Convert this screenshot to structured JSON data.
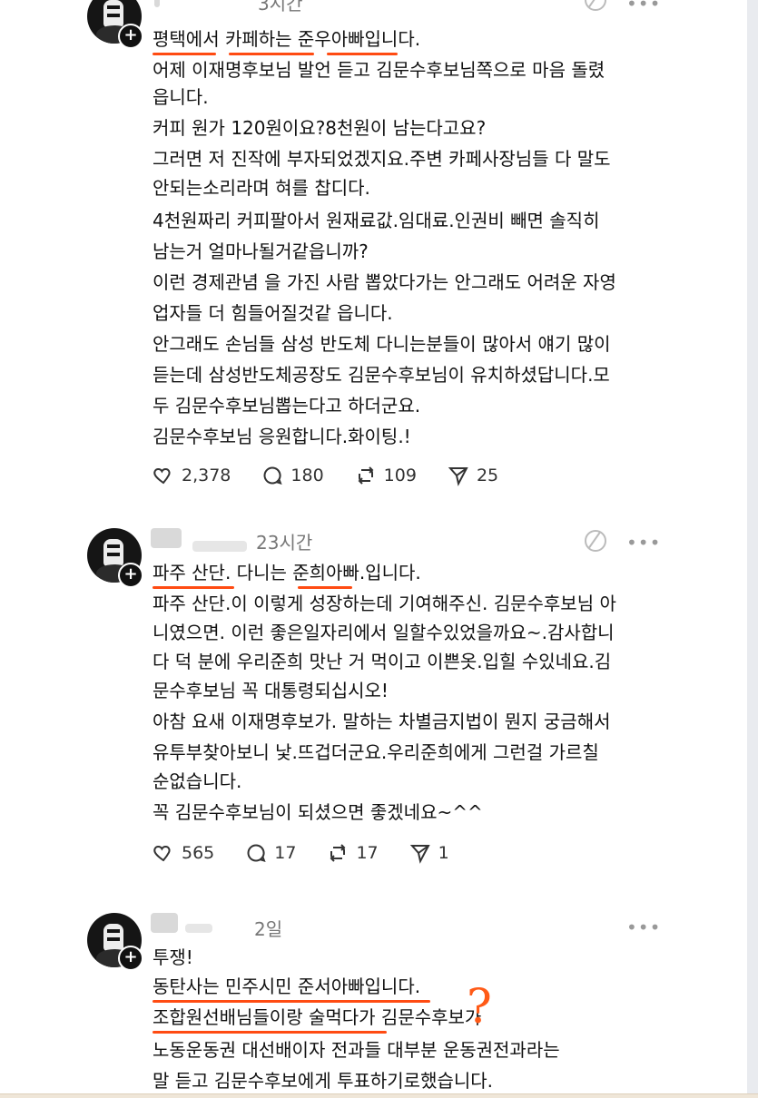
{
  "posts": [
    {
      "time": "3시간",
      "lines": [
        "평택에서 카페하는 준우아빠입니다.",
        "어제 이재명후보님 발언 듣고 김문수후보님쪽으로 마음 돌렸",
        "읍니다.",
        "커피 원가 120원이요?8천원이 남는다고요?",
        "그러면 저 진작에 부자되었겠지요.주변 카페사장님들 다 말도",
        "안되는소리라며 혀를 찹디다.",
        "4천원짜리 커피팔아서 원재료값.임대료.인권비 빼면 솔직히",
        "남는거 얼마나될거같읍니까?",
        "이런 경제관념 을 가진 사람 뽑았다가는 안그래도 어려운 자영",
        "업자들 더 힘들어질것같 읍니다.",
        "안그래도 손님들 삼성 반도체 다니는분들이 많아서 얘기 많이",
        "듣는데 삼성반도체공장도 김문수후보님이 유치하셨답니다.모",
        "두 김문수후보님뽑는다고 하더군요.",
        "김문수후보님 응원합니다.화이팅.!"
      ],
      "likes": "2,378",
      "replies": "180",
      "reposts": "109",
      "shares": "25"
    },
    {
      "time": "23시간",
      "lines": [
        "파주 산단. 다니는 준희아빠.입니다.",
        "파주 산단.이 이렇게 성장하는데 기여해주신. 김문수후보님 아",
        "니였으면. 이런 좋은일자리에서 일할수있었을까요~.감사합니",
        "다 덕 분에 우리준희 맛난 거 먹이고 이쁜옷.입힐 수있네요.김",
        "문수후보님 꼭 대통령되십시오!",
        "아참 요새 이재명후보가. 말하는 차별금지법이 뭔지 궁금해서",
        "유투부찾아보니 낯.뜨겁더군요.우리준희에게 그런걸 가르칠",
        "순없습니다.",
        "꼭 김문수후보님이 되셨으면 좋겠네요~^^"
      ],
      "likes": "565",
      "replies": "17",
      "reposts": "17",
      "shares": "1"
    },
    {
      "time": "2일",
      "lines": [
        "투쟁!",
        "동탄사는 민주시민 준서아빠입니다.",
        "조합원선배님들이랑 술먹다가 김문수후보가",
        "노동운동권 대선배이자 전과들 대부분 운동권전과라는",
        "말 듣고 김문수후보에게 투표하기로했습니다."
      ]
    }
  ],
  "annotation": "?",
  "colors": {
    "underline": "#ff4b12",
    "annotation": "#ff5a17"
  }
}
